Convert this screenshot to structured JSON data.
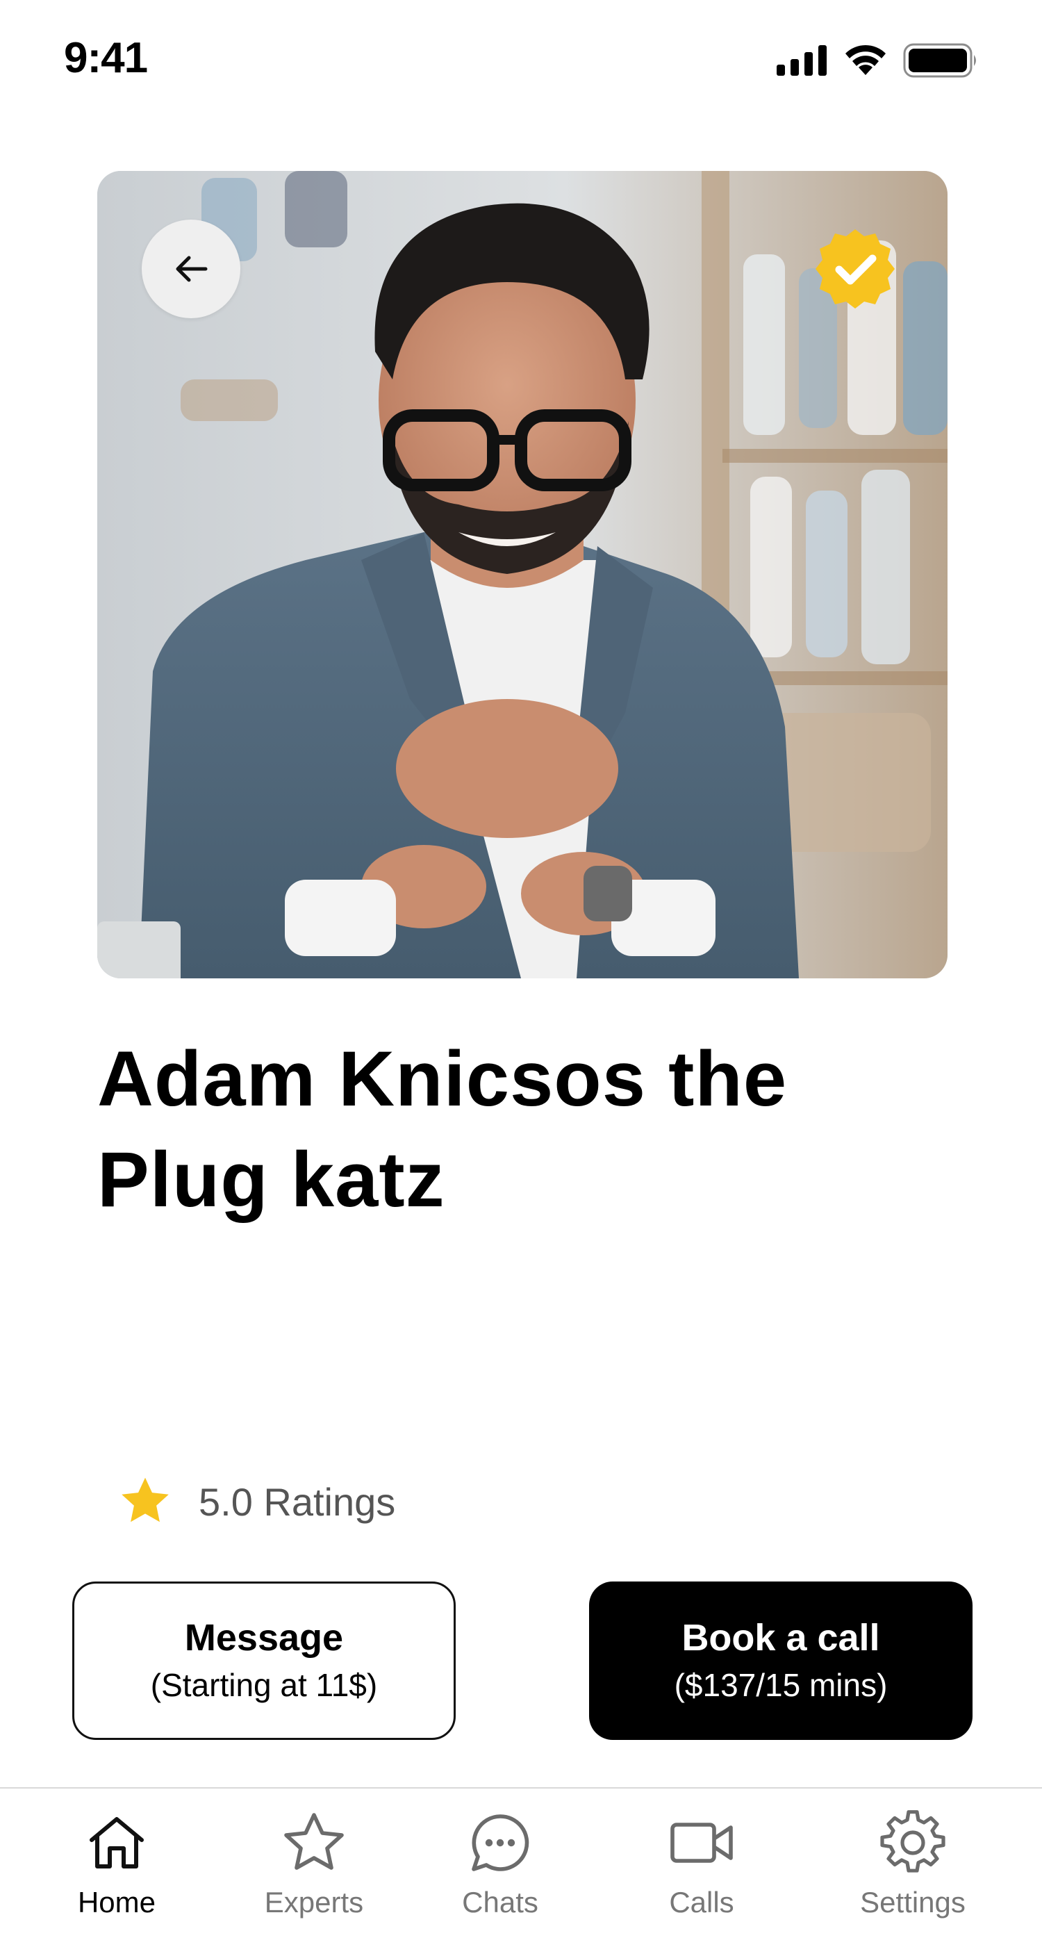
{
  "status_bar": {
    "time": "9:41",
    "icons": [
      "signal-icon",
      "wifi-icon",
      "battery-icon"
    ]
  },
  "profile": {
    "photo": "expert-portrait-photo",
    "back_icon": "arrow-left-icon",
    "verified_icon": "verified-badge-icon",
    "name": "Adam Knicsos the Plug katz",
    "rating_icon": "star-icon",
    "ratings": "5.0 Ratings"
  },
  "actions": {
    "message_title": "Message",
    "message_subtitle": "(Starting at 11$)",
    "book_title": "Book a call",
    "book_subtitle": "($137/15 mins)"
  },
  "tab_bar": {
    "active": "Home",
    "items": [
      {
        "label": "Home",
        "icon": "home-icon"
      },
      {
        "label": "Experts",
        "icon": "star-outline-icon"
      },
      {
        "label": "Chats",
        "icon": "chat-bubble-icon"
      },
      {
        "label": "Calls",
        "icon": "video-camera-icon"
      },
      {
        "label": "Settings",
        "icon": "gear-icon"
      }
    ]
  },
  "colors": {
    "accent_yellow": "#F7C31F",
    "primary_button": "#000000",
    "tab_inactive": "#777777"
  }
}
